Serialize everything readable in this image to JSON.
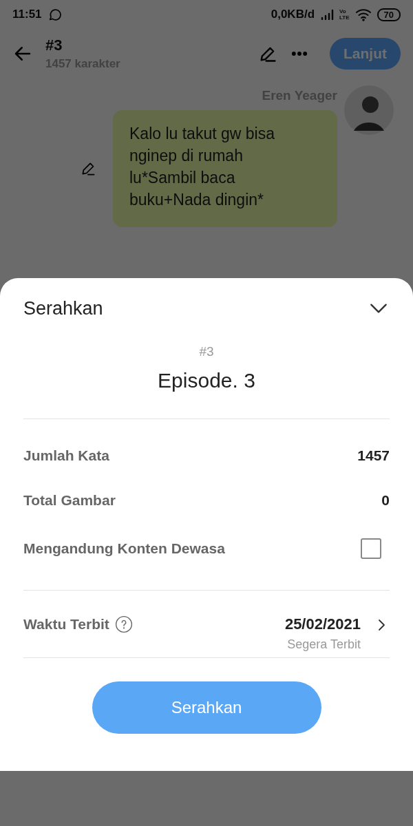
{
  "status_bar": {
    "time": "11:51",
    "data_rate": "0,0KB/d",
    "network": [
      "Vo",
      "LTE"
    ],
    "battery": "70"
  },
  "header": {
    "title": "#3",
    "subtitle": "1457 karakter",
    "next_button": "Lanjut"
  },
  "messages": [
    {
      "author": "Eren Yeager",
      "text": "Kalo lu takut gw bisa nginep di rumah lu*Sambil baca buku+Nada dingin*"
    }
  ],
  "sheet": {
    "title": "Serahkan",
    "episode_number": "#3",
    "episode_title": "Episode. 3",
    "stats": [
      {
        "kind": "value",
        "label": "Jumlah Kata",
        "value": "1457"
      },
      {
        "kind": "value",
        "label": "Total Gambar",
        "value": "0"
      },
      {
        "kind": "checkbox",
        "label": "Mengandung Konten Dewasa",
        "checked": false
      }
    ],
    "publish": {
      "label": "Waktu Terbit",
      "date": "25/02/2021",
      "note": "Segera Terbit"
    },
    "submit_button": "Serahkan"
  }
}
